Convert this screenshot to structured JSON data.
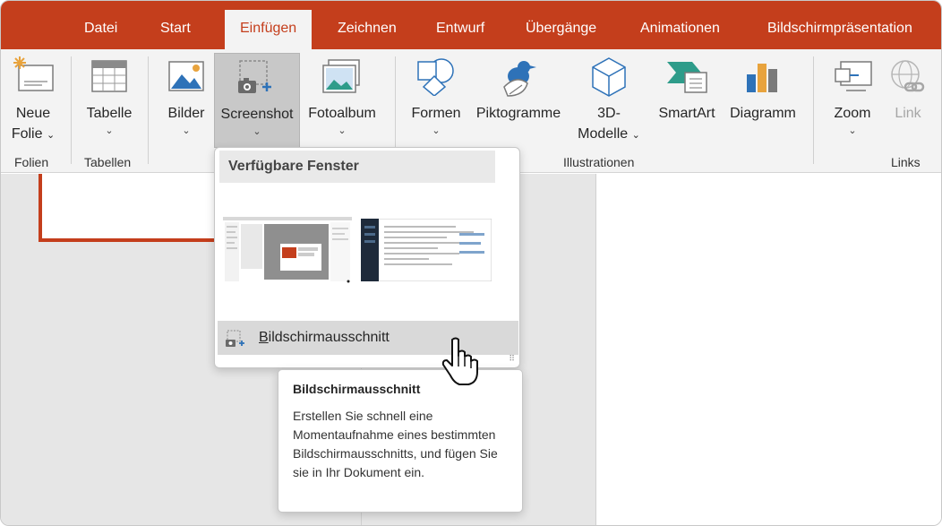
{
  "tabs": [
    {
      "label": "Datei",
      "active": false
    },
    {
      "label": "Start",
      "active": false
    },
    {
      "label": "Einfügen",
      "active": true
    },
    {
      "label": "Zeichnen",
      "active": false
    },
    {
      "label": "Entwurf",
      "active": false
    },
    {
      "label": "Übergänge",
      "active": false
    },
    {
      "label": "Animationen",
      "active": false
    },
    {
      "label": "Bildschirmpräsentation",
      "active": false
    }
  ],
  "ribbon": {
    "new_slide": {
      "line1": "Neue",
      "line2": "Folie",
      "icon": "new-slide-icon"
    },
    "table": {
      "label": "Tabelle",
      "icon": "table-icon"
    },
    "pictures": {
      "label": "Bilder",
      "icon": "picture-icon"
    },
    "screenshot": {
      "label": "Screenshot",
      "icon": "screenshot-icon"
    },
    "photo_album": {
      "label": "Fotoalbum",
      "icon": "photo-album-icon"
    },
    "shapes": {
      "label": "Formen",
      "icon": "shapes-icon"
    },
    "icons": {
      "label": "Piktogramme",
      "icon": "bird-icon"
    },
    "models3d": {
      "line1": "3D-",
      "line2": "Modelle",
      "icon": "cube-icon"
    },
    "smartart": {
      "label": "SmartArt",
      "icon": "smartart-icon"
    },
    "chart": {
      "label": "Diagramm",
      "icon": "chart-icon"
    },
    "zoom": {
      "label": "Zoom",
      "icon": "zoom-icon"
    },
    "link": {
      "label": "Link",
      "icon": "link-icon",
      "disabled": true
    },
    "chevron": "⌄",
    "groups": {
      "slides": "Folien",
      "tables": "Tabellen",
      "illustrations": "Illustrationen",
      "links": "Links"
    }
  },
  "dropdown": {
    "header": "Verfügbare Fenster",
    "item_first_letter": "B",
    "item_rest": "ildschirmausschnitt",
    "grip": "⠿"
  },
  "tooltip": {
    "title": "Bildschirmausschnitt",
    "body": "Erstellen Sie schnell eine Momentaufnahme eines bestimmten Bildschirmausschnitts, und fügen Sie sie in Ihr Dokument ein."
  },
  "colors": {
    "accent": "#c43e1c",
    "ribbon_bg": "#f3f3f3",
    "workspace_bg": "#e6e6e6"
  }
}
